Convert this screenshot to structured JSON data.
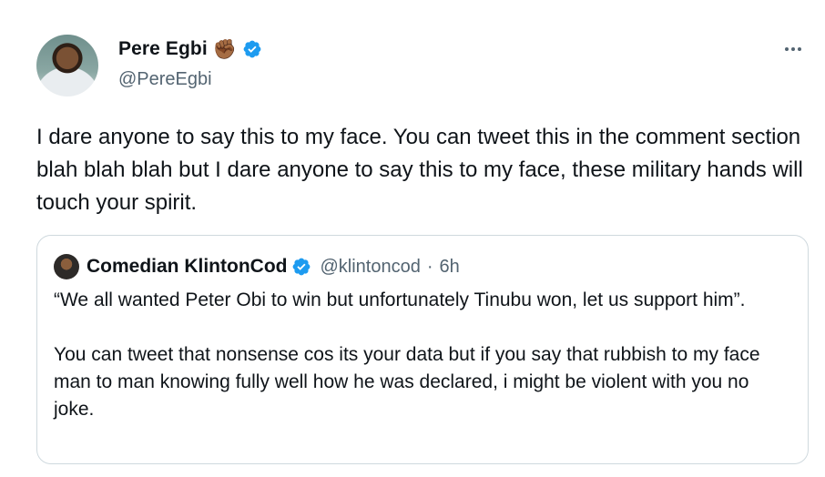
{
  "author": {
    "display_name": "Pere Egbi",
    "emoji": "✊🏾",
    "handle": "@PereEgbi",
    "verified": true
  },
  "tweet_text": "I dare anyone to say this to my face. You can tweet this in the comment section blah blah blah but I dare anyone to say this to my face, these military hands will touch your spirit.",
  "quoted": {
    "display_name": "Comedian KlintonCod",
    "handle": "@klintoncod",
    "separator": "·",
    "time": "6h",
    "verified": true,
    "text": "“We all wanted Peter Obi to win but unfortunately Tinubu won, let us support him”.\n\nYou can tweet that nonsense cos its your data but if you say that rubbish to my face man to man knowing fully well how he was declared, i might be violent with you no joke."
  },
  "colors": {
    "verified": "#1d9bf0",
    "secondary_text": "#536471",
    "border": "#cfd9de"
  }
}
